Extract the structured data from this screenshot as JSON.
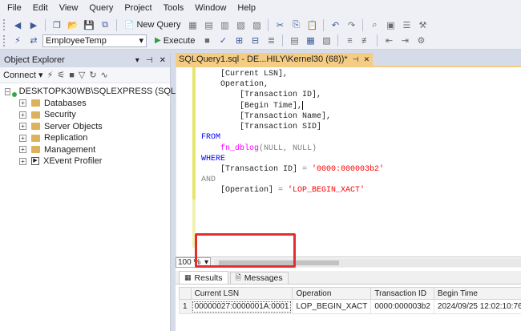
{
  "menu": [
    "File",
    "Edit",
    "View",
    "Query",
    "Project",
    "Tools",
    "Window",
    "Help"
  ],
  "toolbar": {
    "new_query": "New Query",
    "execute": "Execute",
    "database": "EmployeeTemp"
  },
  "object_explorer": {
    "title": "Object Explorer",
    "connect": "Connect",
    "server": "DESKTOPK30WB\\SQLEXPRESS (SQL Serv",
    "nodes": [
      "Databases",
      "Security",
      "Server Objects",
      "Replication",
      "Management",
      "XEvent Profiler"
    ]
  },
  "editor": {
    "tab_title": "SQLQuery1.sql - DE...HILY\\Kernel30 (68))*",
    "zoom": "100 %",
    "lines": {
      "l1": "    [Current LSN],",
      "l2": "    Operation,",
      "l3": "        [Transaction ID],",
      "l4": "        [Begin Time],",
      "l5": "        [Transaction Name],",
      "l6": "        [Transaction SID]",
      "from": "FROM",
      "fn": "fn_dblog",
      "fn_args": "(NULL, NULL)",
      "where": "WHERE",
      "tid_col": "[Transaction ID]",
      "tid_val": "'0000:000003b2'",
      "and": "AND",
      "op_col": "[Operation]",
      "op_val": "'LOP_BEGIN_XACT'",
      "eq": " = "
    }
  },
  "results": {
    "tab_results": "Results",
    "tab_messages": "Messages",
    "columns": [
      "Current LSN",
      "Operation",
      "Transaction ID",
      "Begin Time"
    ],
    "row": {
      "num": "1",
      "lsn": "00000027:0000001A:0001",
      "operation": "LOP_BEGIN_XACT",
      "tid": "0000:000003b2",
      "begin": "2024/09/25 12:02:10:767"
    }
  },
  "colors": {
    "highlight": "#e23030",
    "active_tab": "#f5cc84"
  }
}
